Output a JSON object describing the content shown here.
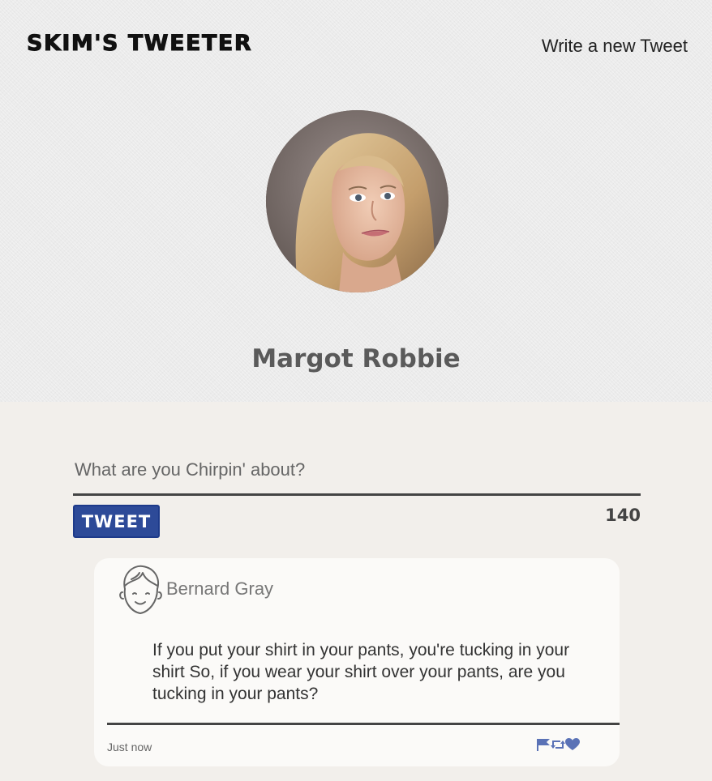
{
  "header": {
    "brand": "SKIM'S TWEETER",
    "new_tweet_link": "Write a new Tweet"
  },
  "profile": {
    "name": "Margot Robbie",
    "avatar_icon": "profile-photo"
  },
  "compose": {
    "placeholder": "What are you Chirpin' about?",
    "value": "",
    "button_label": "TWEET",
    "char_count": "140"
  },
  "tweets": [
    {
      "author": "Bernard Gray",
      "avatar_icon": "face-outline-icon",
      "text": "If you put your shirt in your pants, you're tucking in your shirt So, if you wear your shirt over your pants, are you tucking in your pants?",
      "time": "Just now",
      "actions": [
        "flag-icon",
        "retweet-icon",
        "heart-icon"
      ]
    }
  ],
  "colors": {
    "accent": "#2d4a98",
    "action_icon": "#5a72b6",
    "hero_bg": "#ebebeb",
    "page_bg": "#f2efeb"
  }
}
